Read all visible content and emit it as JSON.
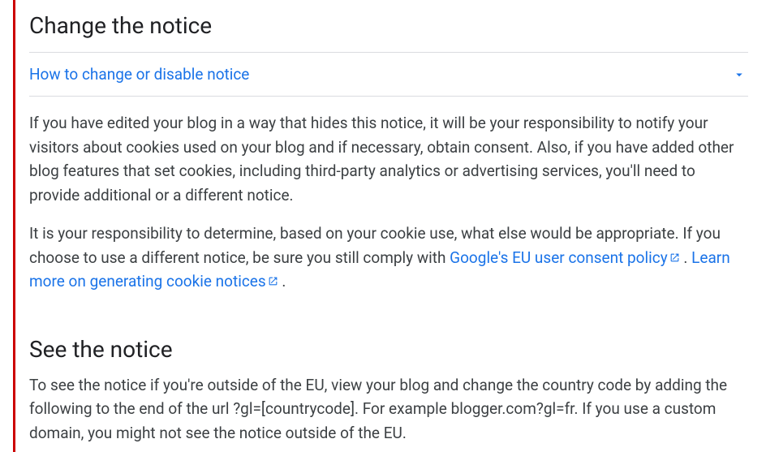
{
  "section1": {
    "heading": "Change the notice",
    "expander_label": "How to change or disable notice",
    "para1": "If you have edited your blog in a way that hides this notice, it will be your responsibility to notify your visitors about cookies used on your blog and if necessary, obtain consent. Also, if you have added other blog features that set cookies, including third-party analytics or advertising services, you'll need to provide additional or a different notice.",
    "para2_a": "It is your responsibility to determine, based on your cookie use, what else would be appropriate. If you choose to use a different notice, be sure you still comply with ",
    "link1": "Google's EU user consent policy",
    "para2_b": " . ",
    "link2": "Learn more on generating cookie notices",
    "para2_c": " ."
  },
  "section2": {
    "heading": "See the notice",
    "para1": "To see the notice if you're outside of the EU, view your blog and change the country code by adding the following to the end of the url ?gl=[countrycode]. For example blogger.com?gl=fr. If you use a custom domain, you might not see the notice outside of the EU."
  }
}
